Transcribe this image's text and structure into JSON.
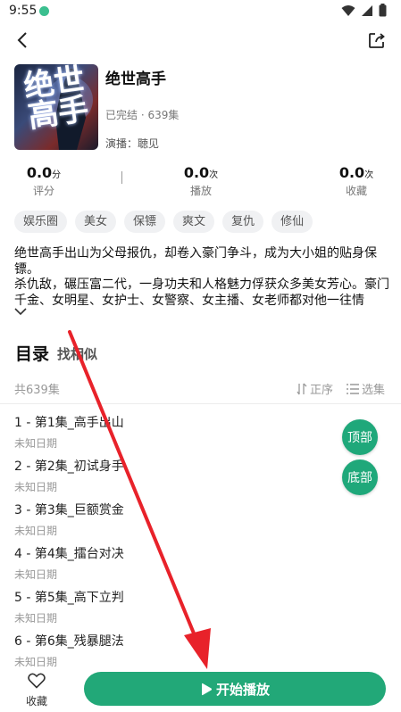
{
  "status": {
    "time": "9:55"
  },
  "book": {
    "title": "绝世高手",
    "cover_text": "绝世高手",
    "status_line": "已完结 · 639集",
    "narrator": "演播：聴见"
  },
  "stats": [
    {
      "value": "0.0",
      "unit": "分",
      "label": "评分"
    },
    {
      "value": "0.0",
      "unit": "次",
      "label": "播放"
    },
    {
      "value": "0.0",
      "unit": "次",
      "label": "收藏"
    }
  ],
  "tags": [
    "娱乐圈",
    "美女",
    "保镖",
    "爽文",
    "复仇",
    "修仙"
  ],
  "description": {
    "line1": "绝世高手出山为父母报仇，却卷入豪门争斗，成为大小姐的贴身保镖。",
    "line2": "杀仇敌，碾压富二代，一身功夫和人格魅力俘获众多美女芳心。豪门千金、女明星、女护士、女警察、女主播、女老师都对他一往情"
  },
  "catalog": {
    "title": "目录",
    "similar": "找相似",
    "total": "共639集",
    "order_label": "正序",
    "select_label": "选集"
  },
  "episodes": [
    {
      "title": "1 - 第1集_高手出山",
      "date": "未知日期"
    },
    {
      "title": "2 - 第2集_初试身手",
      "date": "未知日期"
    },
    {
      "title": "3 - 第3集_巨额赏金",
      "date": "未知日期"
    },
    {
      "title": "4 - 第4集_擂台对决",
      "date": "未知日期"
    },
    {
      "title": "5 - 第5集_高下立判",
      "date": "未知日期"
    },
    {
      "title": "6 - 第6集_残暴腿法",
      "date": "未知日期"
    }
  ],
  "floating": {
    "top_label": "顶部",
    "bottom_label": "底部"
  },
  "bottom": {
    "favorite_label": "收藏",
    "play_label": "开始播放"
  },
  "colors": {
    "accent": "#22a878",
    "annotation_arrow": "#e8222a"
  },
  "icons": {
    "back": "back-arrow-icon",
    "share": "share-icon",
    "heart": "heart-icon",
    "play": "play-icon"
  }
}
